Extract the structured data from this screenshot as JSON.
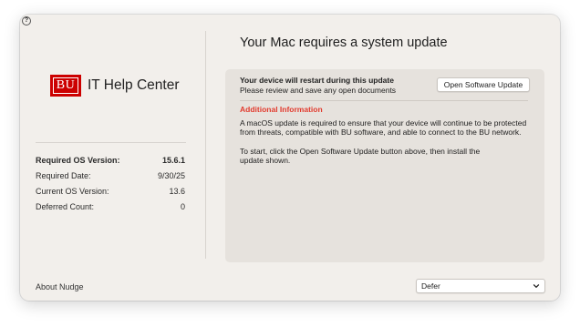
{
  "help": {
    "glyph": "?"
  },
  "branding": {
    "logo_mark": "BU",
    "name": "IT Help Center",
    "brand_color": "#cc0000"
  },
  "info": {
    "rows": [
      {
        "label": "Required OS Version:",
        "value": "15.6.1"
      },
      {
        "label": "Required Date:",
        "value": "9/30/25"
      },
      {
        "label": "Current OS Version:",
        "value": "13.6"
      },
      {
        "label": "Deferred Count:",
        "value": "0"
      }
    ]
  },
  "main": {
    "title": "Your Mac requires a system update",
    "restart_title": "Your device will restart during this update",
    "restart_subtitle": "Please review and save any open documents",
    "open_button_label": "Open Software Update",
    "additional_title": "Additional Information",
    "additional_title_color": "#e23b2e",
    "paragraph1_line1": "A macOS update is required to ensure that your device will continue to be protected",
    "paragraph1_line2": "from threats, compatible with BU software, and able to connect to the BU network.",
    "paragraph2_line1": "To start, click the Open Software Update button above, then install the",
    "paragraph2_line2": "update shown."
  },
  "footer": {
    "about_label": "About Nudge",
    "defer_selected": "Defer",
    "chevron_icon": "chevron-down-icon"
  }
}
